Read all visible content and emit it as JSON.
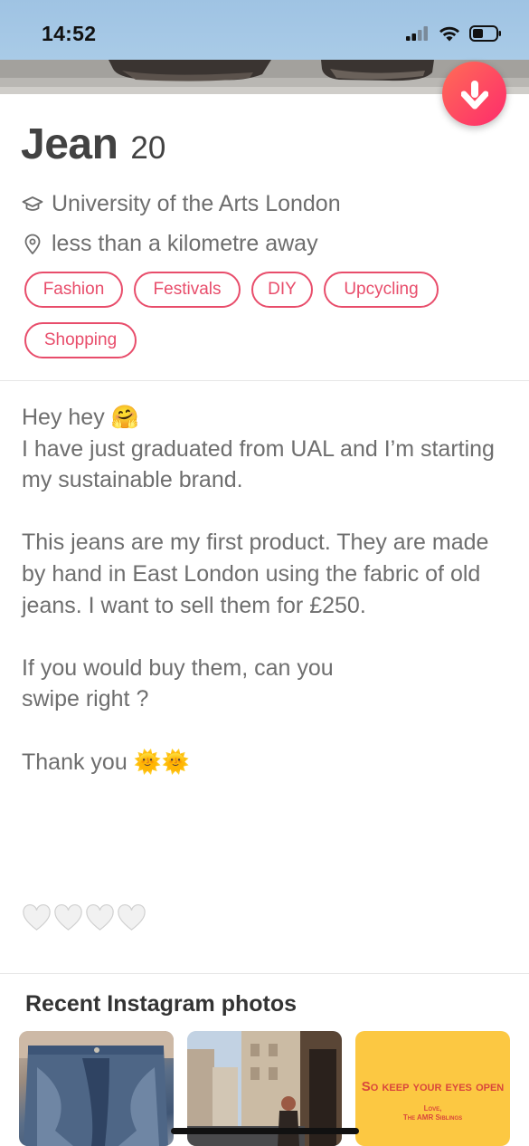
{
  "status_bar": {
    "time": "14:52",
    "icons": [
      "cellular-signal-icon",
      "wifi-icon",
      "battery-icon"
    ]
  },
  "profile": {
    "name": "Jean",
    "age": "20",
    "school": "University of the Arts London",
    "distance": "less than a kilometre away",
    "school_icon": "graduation-cap-icon",
    "location_icon": "location-pin-icon"
  },
  "actions": {
    "collapse_icon": "arrow-down-icon"
  },
  "interests": [
    "Fashion",
    "Festivals",
    "DIY",
    "Upcycling",
    "Shopping"
  ],
  "bio": {
    "line1": "Hey hey 🤗",
    "line2": "I have just graduated from UAL and I’m starting my sustainable brand.",
    "para2": "This jeans are my first product. They are made by hand in East London using the fabric of old jeans. I want to sell them for £250.",
    "para3a": "If you would buy them, can you",
    "para3b": "swipe right ?",
    "para4": "Thank you 🌞🌞"
  },
  "hearts": [
    "🤍",
    "🤍",
    "🤍",
    "🤍"
  ],
  "instagram": {
    "title": "Recent Instagram photos",
    "photo3_main": "So keep your eyes open",
    "photo3_sub1": "Love,",
    "photo3_sub2": "The AMR Siblings"
  },
  "colors": {
    "accent": "#e84d6b",
    "fab_gradient_start": "#ff6d56",
    "fab_gradient_end": "#fd2b6c",
    "text_primary": "#424242",
    "text_secondary": "#6e6e6e"
  }
}
